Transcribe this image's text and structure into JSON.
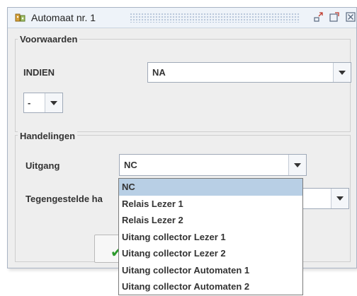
{
  "window": {
    "title": "Automaat nr. 1"
  },
  "voorwaarden": {
    "title": "Voorwaarden",
    "indien_label": "INDIEN",
    "indien_value": "NA",
    "small_value": "-"
  },
  "handelingen": {
    "title": "Handelingen",
    "uitgang_label": "Uitgang",
    "uitgang_value": "NC",
    "tegengestelde_label": "Tegengestelde ha"
  },
  "dropdown": {
    "items": [
      "NC",
      "Relais  Lezer 1",
      "Relais  Lezer 2",
      "Uitang collector  Lezer 1",
      "Uitang collector  Lezer 2",
      "Uitang collector  Automaten 1",
      "Uitang collector  Automaten 2"
    ],
    "selected_index": 0
  },
  "icons": {
    "title": "app-icon",
    "minimize": "minimize-icon",
    "maximize": "maximize-icon",
    "close": "close-icon",
    "ok": "checkmark-icon"
  },
  "colors": {
    "selection": "#b8cfe5",
    "checkmark": "#2c9a2c"
  }
}
